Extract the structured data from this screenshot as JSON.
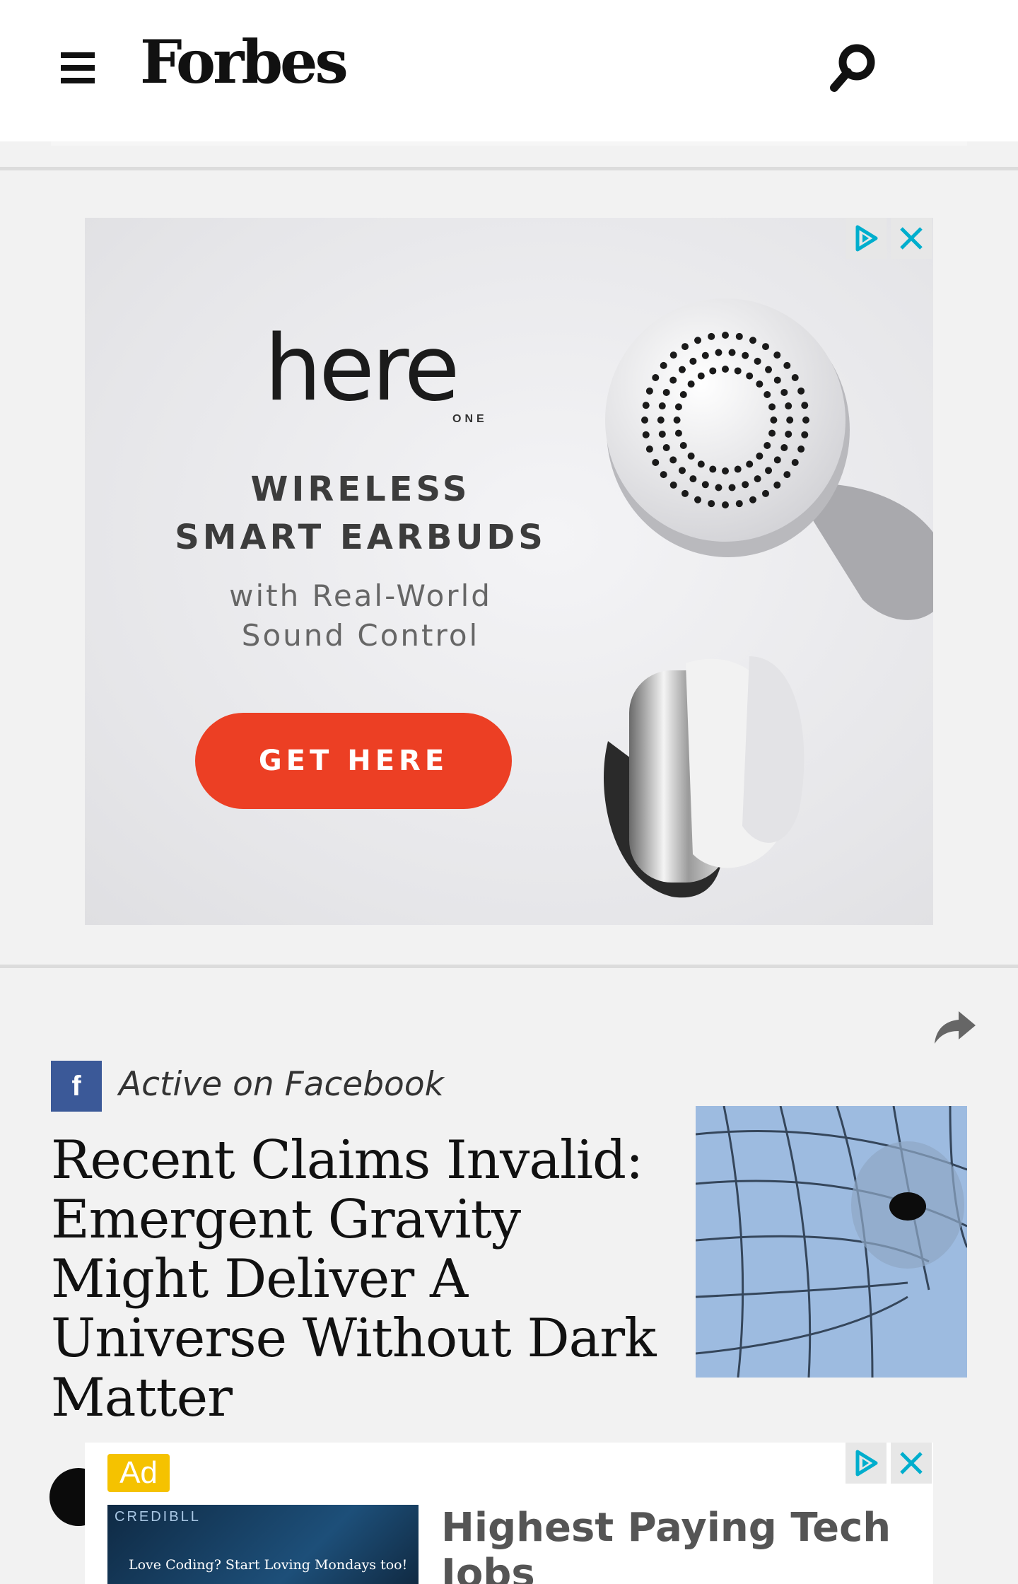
{
  "header": {
    "logo": "Forbes",
    "menu_icon": "hamburger-menu-icon",
    "search_icon": "search-icon"
  },
  "ad_banner": {
    "brand": "here",
    "brand_sub": "ONE",
    "headline_line1": "WIRELESS",
    "headline_line2": "SMART EARBUDS",
    "subtext_line1": "with Real-World",
    "subtext_line2": "Sound Control",
    "cta": "GET HERE",
    "cta_color": "#ec3f24",
    "adchoices_icon": "adchoices-icon",
    "close_icon": "close-icon"
  },
  "article": {
    "share_icon": "share-icon",
    "badge_icon": "facebook-icon",
    "badge_label": "Active on Facebook",
    "badge_color": "#3b5998",
    "headline": "Recent Claims Invalid: Emergent Gravity Might Deliver A Universe Without Dark Matter"
  },
  "bottom_ad": {
    "tag": "Ad",
    "tag_color": "#f5c200",
    "image_brand": "CREDIBLL",
    "image_caption": "Love Coding? Start Loving Mondays too!",
    "title": "Highest Paying Tech Jobs"
  },
  "colors": {
    "adchoices_accent": "#00aecd",
    "page_background": "#f2f2f2"
  }
}
